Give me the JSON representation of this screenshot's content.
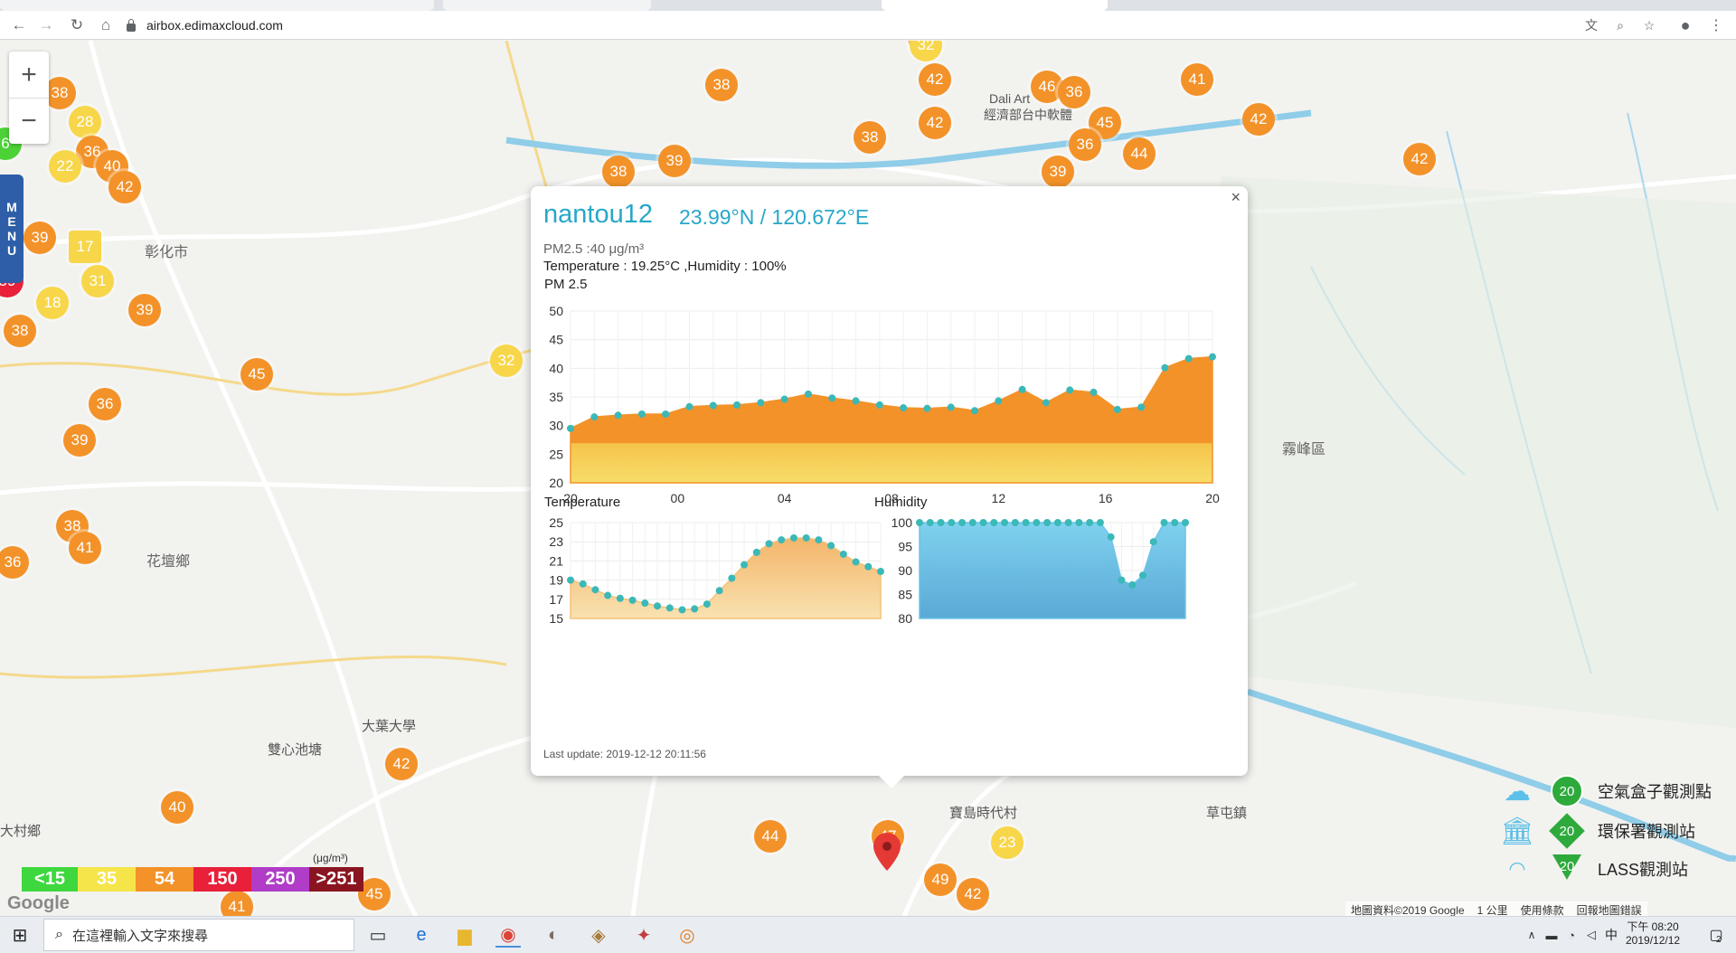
{
  "browser": {
    "url": "airbox.edimaxcloud.com",
    "nav": [
      "back-icon",
      "forward-icon",
      "reload-icon",
      "home-icon"
    ],
    "right_icons": [
      "translate-icon",
      "zoom-icon",
      "star-icon",
      "account-icon",
      "more-icon"
    ]
  },
  "map": {
    "zoom_in": "+",
    "zoom_out": "−",
    "menu_label": [
      "M",
      "E",
      "N",
      "U"
    ],
    "places": [
      {
        "name": "彰化市"
      },
      {
        "name": "花壇鄉"
      },
      {
        "name": "雙心池塘"
      },
      {
        "name": "大葉大學"
      },
      {
        "name": "大村鄉"
      },
      {
        "name": "寶島時代村"
      },
      {
        "name": "草屯鎮"
      },
      {
        "name": "霧峰區"
      },
      {
        "name": "經濟部台中軟體"
      },
      {
        "name": "Dali Art"
      }
    ],
    "clusters": [
      "38",
      "28",
      "36",
      "40",
      "42",
      "22",
      "39",
      "17",
      "31",
      "18",
      "59",
      "38",
      "39",
      "45",
      "36",
      "39",
      "38",
      "41",
      "36",
      "42",
      "40",
      "41",
      "45",
      "38",
      "39",
      "38",
      "42",
      "42",
      "38",
      "42",
      "46",
      "36",
      "45",
      "36",
      "44",
      "39",
      "41",
      "42",
      "41",
      "32",
      "44",
      "47",
      "23",
      "49",
      "42",
      "32",
      "6"
    ]
  },
  "legend_scale": {
    "unit": "(μg/m³)",
    "items": [
      {
        "label": "<15",
        "color": "#3ed83e"
      },
      {
        "label": "35",
        "color": "#f5e54a"
      },
      {
        "label": "54",
        "color": "#f39229"
      },
      {
        "label": "150",
        "color": "#e8203a"
      },
      {
        "label": "250",
        "color": "#b03cc8"
      },
      {
        "label": ">251",
        "color": "#8a1520"
      }
    ]
  },
  "legend_types": [
    {
      "icon": "airbox-icon",
      "value": "20",
      "label": "空氣盒子觀測點",
      "color": "#2eaa3c"
    },
    {
      "icon": "government-building-icon",
      "value": "20",
      "label": "環保署觀測站",
      "color": "#2eaa3c"
    },
    {
      "icon": "lass-station-icon",
      "value": "20",
      "label": "LASS觀測站",
      "color": "#2eaa3c"
    }
  ],
  "attribution": {
    "data": "地圖資料©2019 Google",
    "scale": "1 公里",
    "terms": "使用條款",
    "report": "回報地圖錯誤"
  },
  "google_logo": "Google",
  "popup": {
    "close": "×",
    "title": "nantou12",
    "coords": "23.99°N / 120.672°E",
    "pm_line": "PM2.5 :40 μg/m³",
    "temp_line": "Temperature : 19.25°C ,Humidity : 100%",
    "chart_title": "PM 2.5",
    "last_update": "Last update: 2019-12-12 20:11:56"
  },
  "chart_data": [
    {
      "type": "area",
      "title": "PM 2.5",
      "x_ticks": [
        "20",
        "00",
        "04",
        "08",
        "12",
        "16",
        "20"
      ],
      "ylim": [
        20,
        50
      ],
      "y_ticks": [
        20,
        25,
        30,
        35,
        40,
        45,
        50
      ],
      "grid": true,
      "values": [
        29.5,
        31.5,
        31.8,
        32,
        32,
        33.3,
        33.5,
        33.6,
        34,
        34.6,
        35.5,
        34.8,
        34.3,
        33.6,
        33.1,
        33,
        33.2,
        32.6,
        34.3,
        36.3,
        34,
        36.2,
        35.8,
        32.8,
        33.2,
        40.1,
        41.7,
        42
      ]
    },
    {
      "type": "area",
      "title": "Temperature",
      "ylim": [
        15,
        25
      ],
      "y_ticks": [
        15,
        17,
        19,
        21,
        23,
        25
      ],
      "grid": true,
      "values": [
        19,
        18.6,
        18,
        17.4,
        17.1,
        16.9,
        16.6,
        16.3,
        16.1,
        15.9,
        16,
        16.5,
        17.9,
        19.2,
        20.6,
        21.9,
        22.8,
        23.2,
        23.4,
        23.4,
        23.2,
        22.6,
        21.7,
        20.9,
        20.4,
        19.9
      ]
    },
    {
      "type": "area",
      "title": "Humidity",
      "ylim": [
        80,
        100
      ],
      "y_ticks": [
        80,
        85,
        90,
        95,
        100
      ],
      "grid": true,
      "values": [
        100,
        100,
        100,
        100,
        100,
        100,
        100,
        100,
        100,
        100,
        100,
        100,
        100,
        100,
        100,
        100,
        100,
        100,
        97,
        88,
        87,
        89,
        96,
        100,
        100,
        100
      ]
    }
  ],
  "taskbar": {
    "search_placeholder": "在這裡輸入文字來搜尋",
    "time": "下午 08:20",
    "date": "2019/12/12",
    "ime": "中",
    "notification_count": "2"
  }
}
